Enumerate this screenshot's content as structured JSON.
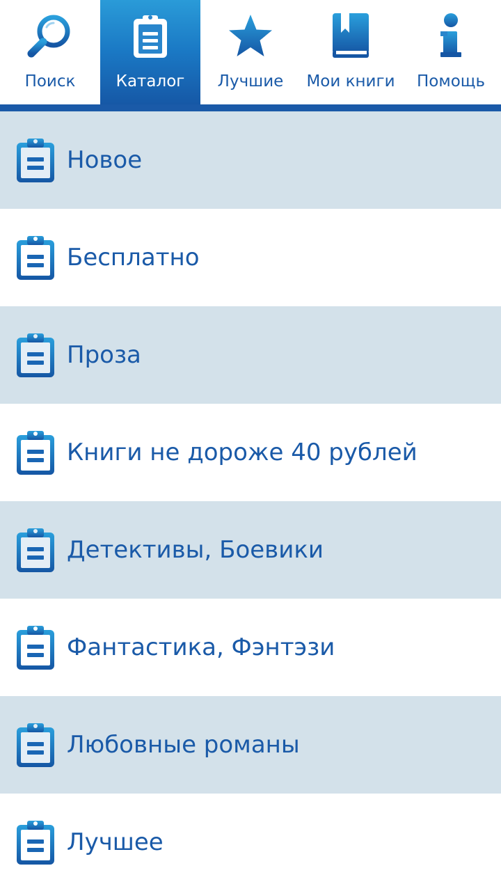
{
  "tabs": [
    {
      "label": "Поиск",
      "icon": "search-icon",
      "active": false
    },
    {
      "label": "Каталог",
      "icon": "clipboard-icon",
      "active": true
    },
    {
      "label": "Лучшие",
      "icon": "star-icon",
      "active": false
    },
    {
      "label": "Мои книги",
      "icon": "book-icon",
      "active": false
    },
    {
      "label": "Помощь",
      "icon": "info-icon",
      "active": false
    }
  ],
  "catalog": {
    "items": [
      {
        "label": "Новое",
        "icon": "clipboard-icon"
      },
      {
        "label": "Бесплатно",
        "icon": "clipboard-icon"
      },
      {
        "label": "Проза",
        "icon": "clipboard-icon"
      },
      {
        "label": "Книги не дороже 40 рублей",
        "icon": "clipboard-icon"
      },
      {
        "label": "Детективы, Боевики",
        "icon": "clipboard-icon"
      },
      {
        "label": "Фантастика, Фэнтэзи",
        "icon": "clipboard-icon"
      },
      {
        "label": "Любовные романы",
        "icon": "clipboard-icon"
      },
      {
        "label": "Лучшее",
        "icon": "clipboard-icon"
      }
    ]
  },
  "colors": {
    "accent": "#1a5aa8",
    "active_tab": "#1a78c4",
    "row_shaded": "#d3e1ea",
    "row_plain": "#ffffff"
  }
}
